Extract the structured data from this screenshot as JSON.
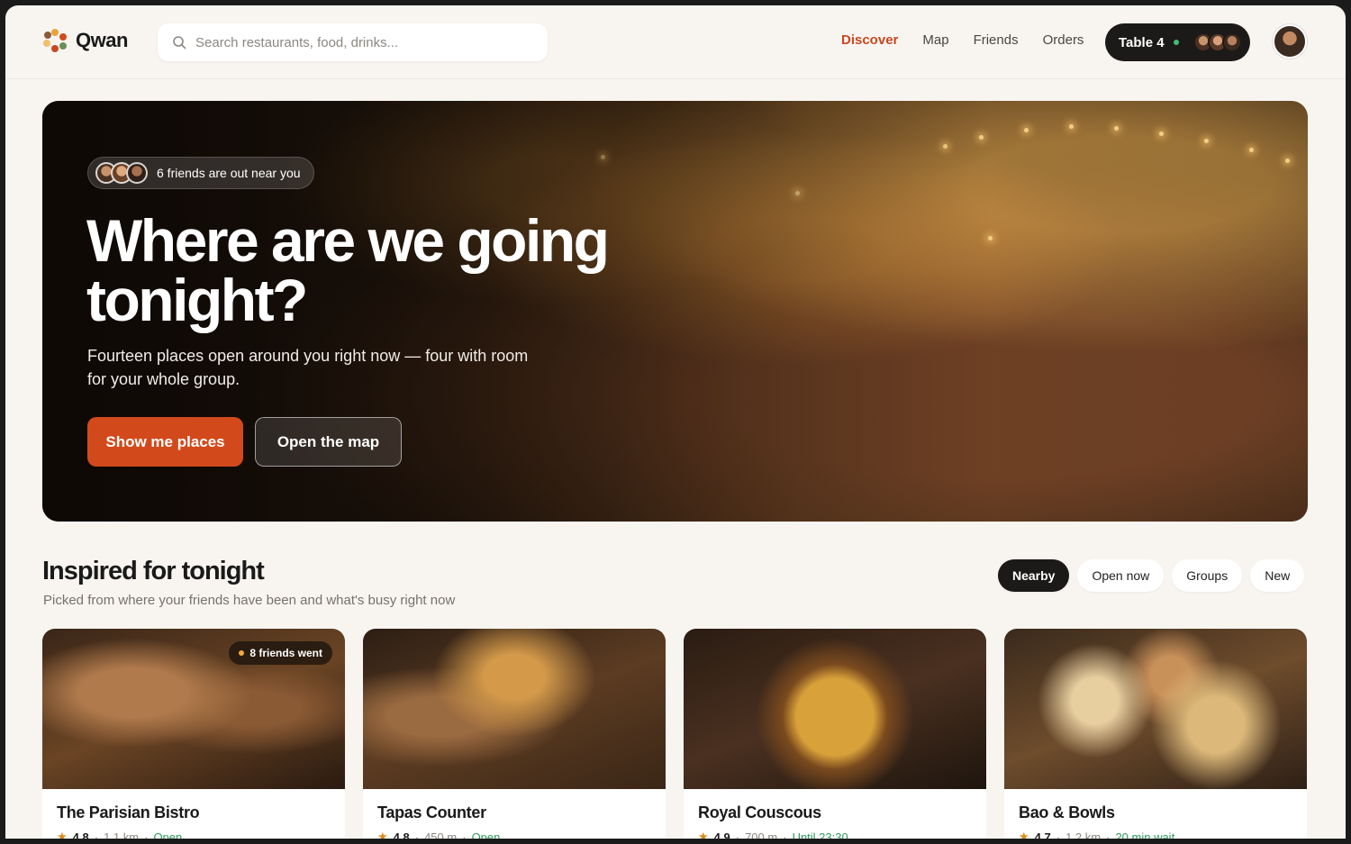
{
  "header": {
    "brand": "Qwan",
    "search_placeholder": "Search restaurants, food, drinks...",
    "nav": [
      "Discover",
      "Map",
      "Friends",
      "Orders"
    ],
    "active_nav": "Discover",
    "table_label": "Table 4",
    "accent": "#c7481f"
  },
  "hero": {
    "friends_chip": "6 friends are out near you",
    "headline": "Where are we going tonight?",
    "subtitle": "Fourteen places open around you right now — four with room for your whole group.",
    "primary_button": "Show me places",
    "secondary_button": "Open the map"
  },
  "section": {
    "title": "Inspired for tonight",
    "subtitle": "Picked from where your friends have been and what's busy right now",
    "filters": [
      "Nearby",
      "Open now",
      "Groups",
      "New"
    ],
    "active_filter": "Nearby"
  },
  "cards": [
    {
      "name": "The Parisian Bistro",
      "rating": "4.8",
      "distance": "1.1 km",
      "status": "Open",
      "badge": "8 friends went"
    },
    {
      "name": "Tapas Counter",
      "rating": "4.8",
      "distance": "450 m",
      "status": "Open"
    },
    {
      "name": "Royal Couscous",
      "rating": "4.9",
      "distance": "700 m",
      "status": "Until 23:30"
    },
    {
      "name": "Bao & Bowls",
      "rating": "4.7",
      "distance": "1.2 km",
      "status": "20 min wait"
    }
  ]
}
